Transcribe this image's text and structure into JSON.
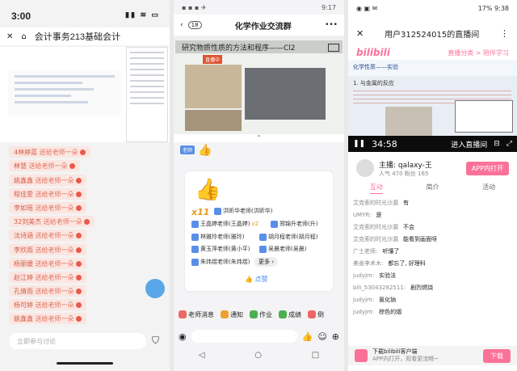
{
  "phone1": {
    "time": "3:00",
    "title": "会计事务213基础会计",
    "chat": [
      {
        "name": "4林婷蓝",
        "text": "送给老师一朵"
      },
      {
        "name": "林慧",
        "text": "送给老师一朵"
      },
      {
        "name": "姚鑫鑫",
        "text": "送给老师一朵"
      },
      {
        "name": "程佳雯",
        "text": "送给老师一朵"
      },
      {
        "name": "李如瑶",
        "text": "送给老师一朵"
      },
      {
        "name": "32刘美杰",
        "text": "送给老师一朵"
      },
      {
        "name": "沈诗涵",
        "text": "送给老师一朵"
      },
      {
        "name": "李欣雨",
        "text": "送给老师一朵"
      },
      {
        "name": "杨丽媛",
        "text": "送给老师一朵"
      },
      {
        "name": "赵江婷",
        "text": "送给老师一朵"
      },
      {
        "name": "孔倩雨",
        "text": "送给老师一朵"
      },
      {
        "name": "杨可婷",
        "text": "送给老师一朵"
      },
      {
        "name": "姚鑫鑫",
        "text": "送给老师一朵"
      }
    ],
    "input_placeholder": "立即参与讨论"
  },
  "phone2": {
    "time": "9:17",
    "badge": "18",
    "title": "化学作业交流群",
    "banner": "研究物质性质的方法和程序——Cl2",
    "live_tag": "直播中",
    "teacher_tag": "老师",
    "count": "x11",
    "likes": [
      {
        "name": "洪昕华老师(洪昕华)"
      },
      {
        "name": "王晶婷老师(王晶婷)",
        "extra": "x2"
      },
      {
        "name": "郑锦升老师(升)"
      },
      {
        "name": "林雅玲老师(雅玲)"
      },
      {
        "name": "胡月程老师(胡月程)"
      },
      {
        "name": "黄玉萍老师(黄小平)"
      },
      {
        "name": "吴晨老师(吴晨)"
      },
      {
        "name": "朱炜煜老师(朱炜煜)"
      }
    ],
    "more": "更多",
    "zan": "点赞",
    "tabs": [
      "老师消息",
      "通知",
      "作业",
      "成绩",
      "倒"
    ]
  },
  "phone3": {
    "time": "9:38",
    "battery": "17%",
    "title": "用户312524015的直播间",
    "logo": "bilibili",
    "links": "直播分类 > 陪伴学习",
    "video_header": "化学性质——实验",
    "video_sub": "1. 与金属的反应",
    "vtime": "34:58",
    "enter": "进入直播间",
    "host_label": "主播:",
    "host_name": "qalaxy-王",
    "stats": "人气 470   粉丝 165",
    "app_btn": "APP内打开",
    "tabs": [
      "互动",
      "简介",
      "活动"
    ],
    "messages": [
      {
        "user": "艾克索的时光沙漏",
        "text": "有"
      },
      {
        "user": "UMYR:",
        "text": "是"
      },
      {
        "user": "艾克索的时光沙漏",
        "text": "不会"
      },
      {
        "user": "艾克索的时光沙漏",
        "text": "能看到画面呀"
      },
      {
        "user": "广土老师:",
        "text": "听懂了"
      },
      {
        "user": "美善李术木:",
        "text": "都忘了, 好理科"
      },
      {
        "user": "judyjm:",
        "text": "实验法"
      },
      {
        "user": "bili_53043282511:",
        "text": "剧烈燃烧"
      },
      {
        "user": "judyjm:",
        "text": "氯化钠"
      },
      {
        "user": "judyjm:",
        "text": "棕色的烟"
      }
    ],
    "download_title": "下载bilibili客户端",
    "download_sub": "APP内打开，观看更流畅~",
    "download_btn": "下载"
  }
}
